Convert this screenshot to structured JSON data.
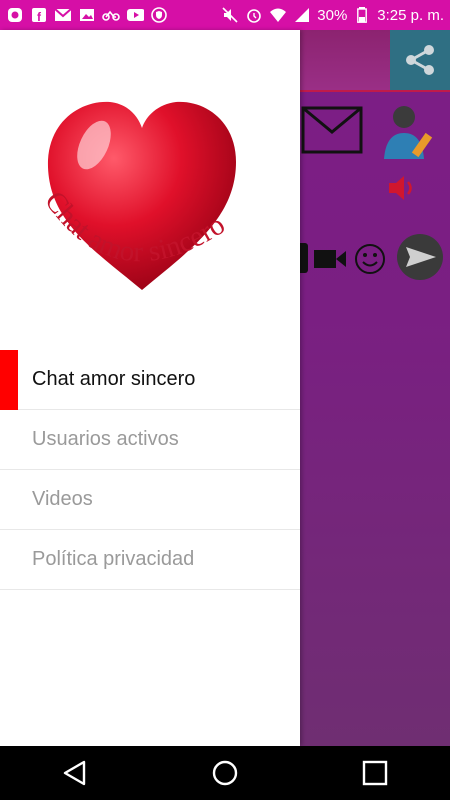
{
  "status_bar": {
    "battery": "30%",
    "time": "3:25 p. m."
  },
  "drawer": {
    "logo_text": "Chat amor sincero",
    "menu": [
      {
        "label": "Chat amor sincero",
        "active": true
      },
      {
        "label": "Usuarios activos",
        "active": false
      },
      {
        "label": "Videos",
        "active": false
      },
      {
        "label": "Política privacidad",
        "active": false
      }
    ]
  },
  "colors": {
    "status_bar": "#d60fa6",
    "accent": "#ff0000",
    "heart": "#e0102a",
    "app_background": "#7d1d86"
  },
  "icons": {
    "status_left": [
      "notification-icon",
      "facebook-icon",
      "gmail-icon",
      "image-icon",
      "bike-icon",
      "youtube-icon",
      "shield-icon"
    ],
    "status_right": [
      "mute-icon",
      "alarm-icon",
      "wifi-icon",
      "signal-icon",
      "battery-icon"
    ],
    "app": [
      "share-icon",
      "mail-icon",
      "user-edit-icon",
      "speaker-icon",
      "video-icon",
      "emoji-icon",
      "send-icon"
    ],
    "nav": [
      "back-icon",
      "home-icon",
      "recents-icon"
    ]
  }
}
